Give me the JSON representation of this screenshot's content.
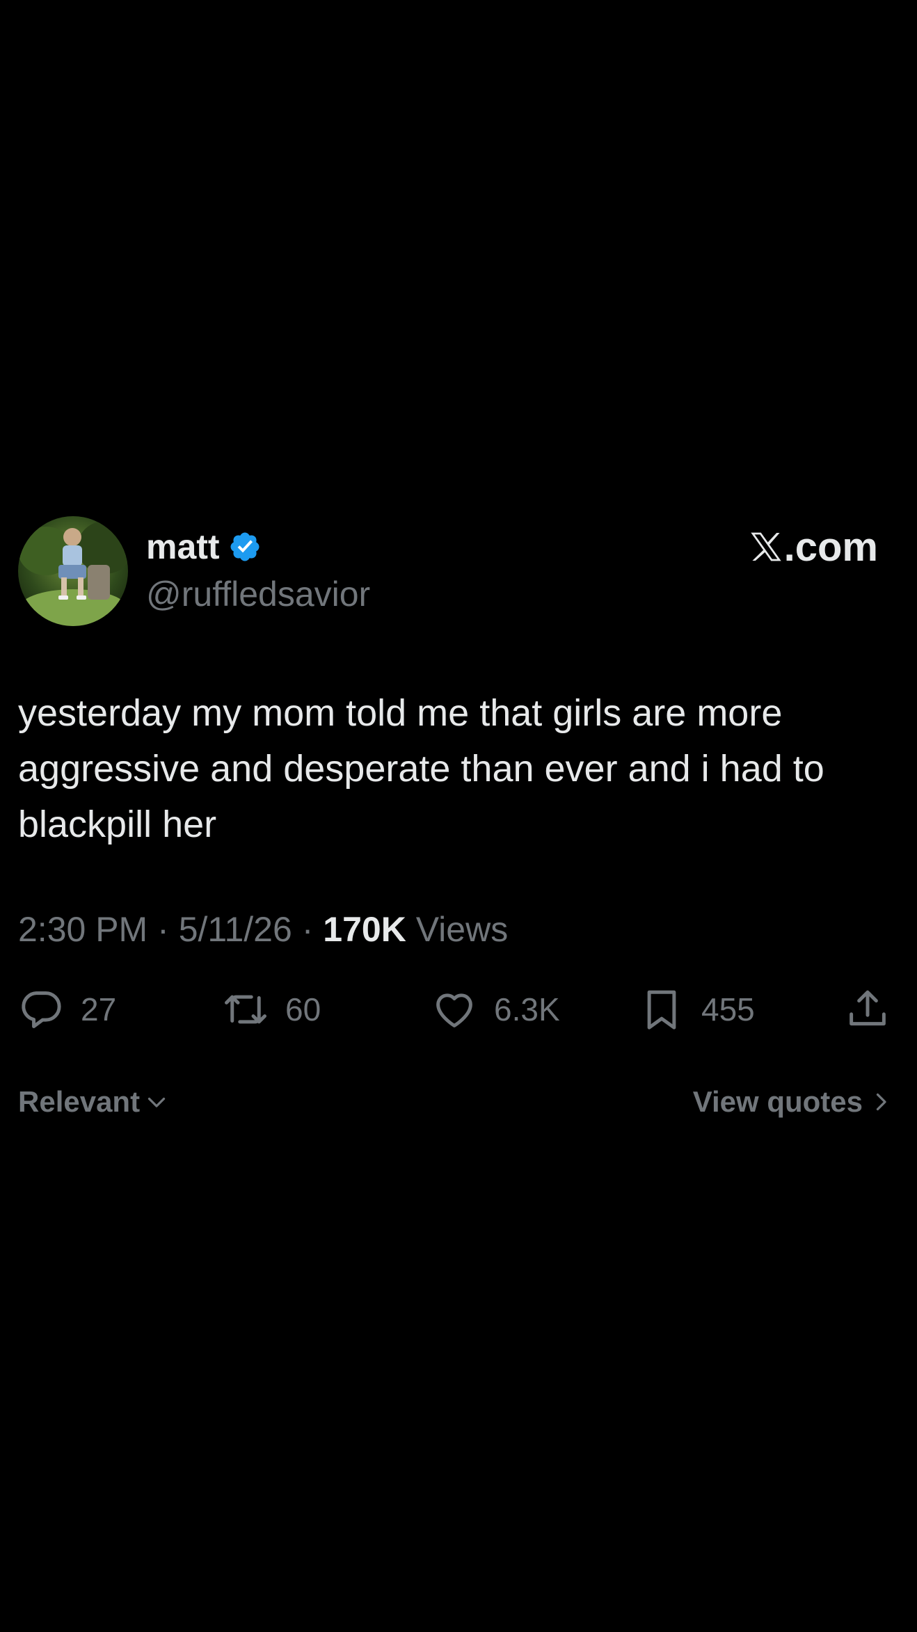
{
  "author": {
    "display_name": "matt",
    "handle": "@ruffledsavior",
    "verified": true
  },
  "brand": {
    "label": ".com",
    "logo": "x-logo-icon"
  },
  "tweet": {
    "text": "yesterday my mom told me that girls are more aggressive and desperate than ever and i had to blackpill her",
    "time": "2:30 PM",
    "date": "5/11/26",
    "separator": "·",
    "views_count": "170K",
    "views_label": "Views"
  },
  "actions": {
    "replies": "27",
    "reposts": "60",
    "likes": "6.3K",
    "bookmarks": "455"
  },
  "footer": {
    "sort_label": "Relevant",
    "quotes_label": "View quotes"
  },
  "colors": {
    "background": "#000000",
    "primary_text": "#e7e9ea",
    "secondary_text": "#71767b",
    "verified_blue": "#1d9bf0"
  }
}
